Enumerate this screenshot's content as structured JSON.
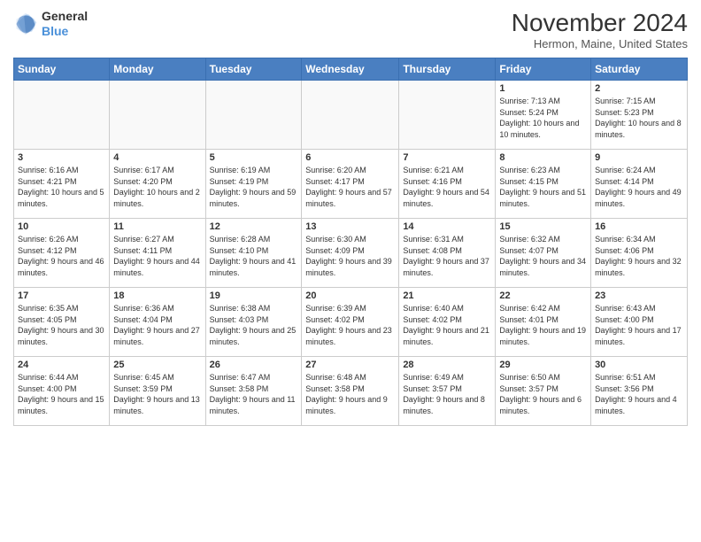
{
  "header": {
    "logo_line1": "General",
    "logo_line2": "Blue",
    "month_title": "November 2024",
    "location": "Hermon, Maine, United States"
  },
  "days_of_week": [
    "Sunday",
    "Monday",
    "Tuesday",
    "Wednesday",
    "Thursday",
    "Friday",
    "Saturday"
  ],
  "weeks": [
    [
      {
        "day": "",
        "info": ""
      },
      {
        "day": "",
        "info": ""
      },
      {
        "day": "",
        "info": ""
      },
      {
        "day": "",
        "info": ""
      },
      {
        "day": "",
        "info": ""
      },
      {
        "day": "1",
        "info": "Sunrise: 7:13 AM\nSunset: 5:24 PM\nDaylight: 10 hours and 10 minutes."
      },
      {
        "day": "2",
        "info": "Sunrise: 7:15 AM\nSunset: 5:23 PM\nDaylight: 10 hours and 8 minutes."
      }
    ],
    [
      {
        "day": "3",
        "info": "Sunrise: 6:16 AM\nSunset: 4:21 PM\nDaylight: 10 hours and 5 minutes."
      },
      {
        "day": "4",
        "info": "Sunrise: 6:17 AM\nSunset: 4:20 PM\nDaylight: 10 hours and 2 minutes."
      },
      {
        "day": "5",
        "info": "Sunrise: 6:19 AM\nSunset: 4:19 PM\nDaylight: 9 hours and 59 minutes."
      },
      {
        "day": "6",
        "info": "Sunrise: 6:20 AM\nSunset: 4:17 PM\nDaylight: 9 hours and 57 minutes."
      },
      {
        "day": "7",
        "info": "Sunrise: 6:21 AM\nSunset: 4:16 PM\nDaylight: 9 hours and 54 minutes."
      },
      {
        "day": "8",
        "info": "Sunrise: 6:23 AM\nSunset: 4:15 PM\nDaylight: 9 hours and 51 minutes."
      },
      {
        "day": "9",
        "info": "Sunrise: 6:24 AM\nSunset: 4:14 PM\nDaylight: 9 hours and 49 minutes."
      }
    ],
    [
      {
        "day": "10",
        "info": "Sunrise: 6:26 AM\nSunset: 4:12 PM\nDaylight: 9 hours and 46 minutes."
      },
      {
        "day": "11",
        "info": "Sunrise: 6:27 AM\nSunset: 4:11 PM\nDaylight: 9 hours and 44 minutes."
      },
      {
        "day": "12",
        "info": "Sunrise: 6:28 AM\nSunset: 4:10 PM\nDaylight: 9 hours and 41 minutes."
      },
      {
        "day": "13",
        "info": "Sunrise: 6:30 AM\nSunset: 4:09 PM\nDaylight: 9 hours and 39 minutes."
      },
      {
        "day": "14",
        "info": "Sunrise: 6:31 AM\nSunset: 4:08 PM\nDaylight: 9 hours and 37 minutes."
      },
      {
        "day": "15",
        "info": "Sunrise: 6:32 AM\nSunset: 4:07 PM\nDaylight: 9 hours and 34 minutes."
      },
      {
        "day": "16",
        "info": "Sunrise: 6:34 AM\nSunset: 4:06 PM\nDaylight: 9 hours and 32 minutes."
      }
    ],
    [
      {
        "day": "17",
        "info": "Sunrise: 6:35 AM\nSunset: 4:05 PM\nDaylight: 9 hours and 30 minutes."
      },
      {
        "day": "18",
        "info": "Sunrise: 6:36 AM\nSunset: 4:04 PM\nDaylight: 9 hours and 27 minutes."
      },
      {
        "day": "19",
        "info": "Sunrise: 6:38 AM\nSunset: 4:03 PM\nDaylight: 9 hours and 25 minutes."
      },
      {
        "day": "20",
        "info": "Sunrise: 6:39 AM\nSunset: 4:02 PM\nDaylight: 9 hours and 23 minutes."
      },
      {
        "day": "21",
        "info": "Sunrise: 6:40 AM\nSunset: 4:02 PM\nDaylight: 9 hours and 21 minutes."
      },
      {
        "day": "22",
        "info": "Sunrise: 6:42 AM\nSunset: 4:01 PM\nDaylight: 9 hours and 19 minutes."
      },
      {
        "day": "23",
        "info": "Sunrise: 6:43 AM\nSunset: 4:00 PM\nDaylight: 9 hours and 17 minutes."
      }
    ],
    [
      {
        "day": "24",
        "info": "Sunrise: 6:44 AM\nSunset: 4:00 PM\nDaylight: 9 hours and 15 minutes."
      },
      {
        "day": "25",
        "info": "Sunrise: 6:45 AM\nSunset: 3:59 PM\nDaylight: 9 hours and 13 minutes."
      },
      {
        "day": "26",
        "info": "Sunrise: 6:47 AM\nSunset: 3:58 PM\nDaylight: 9 hours and 11 minutes."
      },
      {
        "day": "27",
        "info": "Sunrise: 6:48 AM\nSunset: 3:58 PM\nDaylight: 9 hours and 9 minutes."
      },
      {
        "day": "28",
        "info": "Sunrise: 6:49 AM\nSunset: 3:57 PM\nDaylight: 9 hours and 8 minutes."
      },
      {
        "day": "29",
        "info": "Sunrise: 6:50 AM\nSunset: 3:57 PM\nDaylight: 9 hours and 6 minutes."
      },
      {
        "day": "30",
        "info": "Sunrise: 6:51 AM\nSunset: 3:56 PM\nDaylight: 9 hours and 4 minutes."
      }
    ]
  ]
}
